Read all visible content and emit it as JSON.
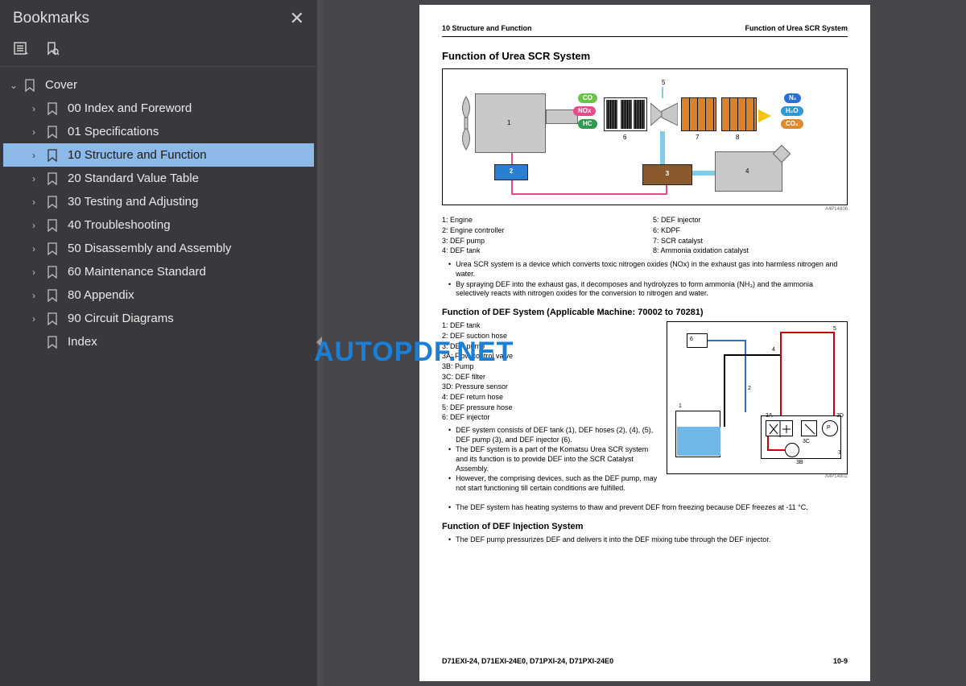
{
  "sidebar": {
    "title": "Bookmarks",
    "root": "Cover",
    "items": [
      "00 Index and Foreword",
      "01 Specifications",
      "10 Structure and Function",
      "20 Standard Value Table",
      "30 Testing and Adjusting",
      "40 Troubleshooting",
      "50 Disassembly and Assembly",
      "60 Maintenance Standard",
      "80 Appendix",
      "90 Circuit Diagrams",
      "Index"
    ],
    "selected_index": 2
  },
  "watermark": "AUTOPDF.NET",
  "page": {
    "header_left": "10 Structure and Function",
    "header_right": "Function of Urea SCR System",
    "title1": "Function of Urea SCR System",
    "diag1_code": "A4P14806",
    "legend1_left": [
      "1: Engine",
      "2: Engine controller",
      "3: DEF pump",
      "4: DEF tank"
    ],
    "legend1_right": [
      "5: DEF injector",
      "6: KDPF",
      "7: SCR catalyst",
      "8: Ammonia oxidation catalyst"
    ],
    "bullets1": [
      "Urea SCR system is a device which converts toxic nitrogen oxides (NOx) in the exhaust gas into harmless nitrogen and water.",
      "By spraying DEF into the exhaust gas, it decomposes and hydrolyzes to form ammonia (NH₃) and the ammonia selectively reacts with nitrogen oxides for the conversion to nitrogen and water."
    ],
    "title2": "Function of DEF System (Applicable Machine: 70002 to 70281)",
    "legend2": [
      "1: DEF tank",
      "2: DEF suction hose",
      "3: DEF pump",
      "3A: Flow control valve",
      "3B: Pump",
      "3C: DEF filter",
      "3D: Pressure sensor",
      "4: DEF return hose",
      "5: DEF pressure hose",
      "6: DEF injector"
    ],
    "bullets2": [
      "DEF system consists of DEF tank (1), DEF hoses (2), (4), (5), DEF pump (3), and DEF injector (6).",
      "The DEF system is a part of the Komatsu Urea SCR system and its function is to provide DEF into the SCR Catalyst Assembly.",
      "However, the comprising devices, such as the DEF pump, may not start functioning till certain conditions are fulfilled."
    ],
    "bullets2_full": [
      "The DEF system has heating systems to thaw and prevent DEF from freezing because DEF freezes at -11 °C."
    ],
    "diag2_code": "A4P14802",
    "title3": "Function of DEF Injection System",
    "bullets3": [
      "The DEF pump pressurizes DEF and delivers it into the DEF mixing tube through the DEF injector."
    ],
    "footer_left": "D71EXI-24, D71EXI-24E0, D71PXI-24, D71PXI-24E0",
    "footer_right": "10-9",
    "diag1_labels": {
      "n1": "1",
      "n2": "2",
      "n3": "3",
      "n4": "4",
      "n5": "5",
      "n6": "6",
      "n7": "7",
      "n8": "8",
      "co": "CO",
      "nox": "NOx",
      "hc": "HC",
      "n2_": "N₂",
      "h2o": "H₂O",
      "co2": "CO₂"
    },
    "diag2_labels": {
      "n1": "1",
      "n2": "2",
      "n3": "3",
      "n3a": "3A",
      "n3b": "3B",
      "n3c": "3C",
      "n3d": "3D",
      "n4": "4",
      "n5": "5",
      "n6": "6",
      "p": "P"
    }
  }
}
